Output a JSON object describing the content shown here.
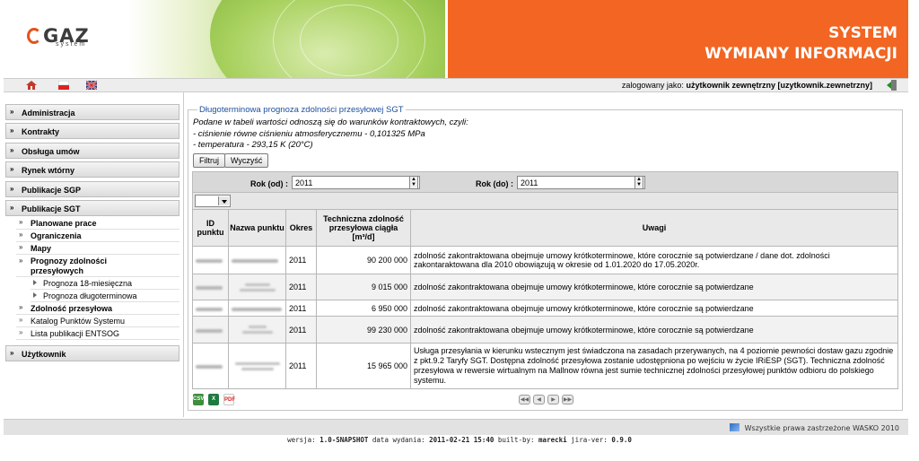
{
  "header": {
    "logo_text": "GAZ",
    "logo_sub": "system",
    "title_line1": "SYSTEM",
    "title_line2": "WYMIANY INFORMACJI"
  },
  "user_bar": {
    "logged_as_label": "zalogowany jako:",
    "user_name": "użytkownik zewnętrzny [uzytkownik.zewnetrzny]",
    "icons": [
      "home-icon",
      "polish-flag-icon",
      "uk-flag-icon",
      "logout-icon"
    ]
  },
  "sidebar": {
    "categories": {
      "administracja": "Administracja",
      "kontrakty": "Kontrakty",
      "obsluga_umow": "Obsługa umów",
      "rynek_wtorny": "Rynek wtórny",
      "publikacje_sgp": "Publikacje SGP",
      "publikacje_sgt": "Publikacje SGT",
      "uzytkownik": "Użytkownik"
    },
    "items": {
      "planowane_prace": "Planowane prace",
      "ograniczenia": "Ograniczenia",
      "mapy": "Mapy",
      "prognozy_line1": "Prognozy zdolności",
      "prognozy_line2": "przesyłowych",
      "prognoza_18": "Prognoza 18-miesięczna",
      "prognoza_dlugo": "Prognoza długoterminowa",
      "zdolnosc": "Zdolność przesyłowa",
      "katalog": "Katalog Punktów Systemu",
      "entsog": "Lista publikacji ENTSOG"
    }
  },
  "content": {
    "legend": "Długoterminowa prognoza zdolności przesyłowej SGT",
    "intro_line1": "Podane w tabeli wartości odnoszą się do warunków kontraktowych, czyli:",
    "intro_line2": "- ciśnienie równe ciśnieniu atmosferycznemu - 0,101325 MPa",
    "intro_line3": "- temperatura - 293,15 K (20°C)",
    "filter_button": "Filtruj",
    "clear_button": "Wyczyść",
    "year_from_label": "Rok (od) :",
    "year_from_value": "2011",
    "year_to_label": "Rok (do) :",
    "year_to_value": "2011"
  },
  "table": {
    "headers": {
      "id": "ID punktu",
      "name": "Nazwa punktu",
      "period": "Okres",
      "capacity_l1": "Techniczna zdolność",
      "capacity_l2": "przesyłowa ciągła",
      "capacity_l3": "[m³/d]",
      "notes": "Uwagi"
    },
    "rows": [
      {
        "period": "2011",
        "capacity": "90 200 000",
        "notes": "zdolność zakontraktowana obejmuje umowy krótkoterminowe, które corocznie są potwierdzane / dane dot. zdolności zakontaraktowana dla 2010 obowiązują w okresie od 1.01.2020 do 17.05.2020r."
      },
      {
        "period": "2011",
        "capacity": "9 015 000",
        "notes": "zdolność zakontraktowana obejmuje umowy krótkoterminowe, które corocznie są potwierdzane"
      },
      {
        "period": "2011",
        "capacity": "6 950 000",
        "notes": "zdolność zakontraktowana obejmuje umowy krótkoterminowe, które corocznie są potwierdzane"
      },
      {
        "period": "2011",
        "capacity": "99 230 000",
        "notes": "zdolność zakontraktowana obejmuje umowy krótkoterminowe, które corocznie są potwierdzane"
      },
      {
        "period": "2011",
        "capacity": "15 965 000",
        "notes": "Usługa przesyłania w kierunku wstecznym jest świadczona na zasadach przerywanych, na 4 poziomie pewności dostaw gazu zgodnie z pkt.9.2 Taryfy SGT. Dostępna zdolność przesyłowa zostanie udostępniona po wejściu w życie IRiESP (SGT). Techniczna zdolność przesyłowa w rewersie wirtualnym na Mallnow równa jest sumie technicznej zdolności przesyłowej punktów odbioru do polskiego systemu."
      }
    ]
  },
  "export_icons": [
    "csv-export-icon",
    "excel-export-icon",
    "pdf-export-icon"
  ],
  "footer": {
    "copyright": "Wszystkie prawa zastrzeżone WASKO 2010",
    "version_label": "wersja:",
    "version": "1.0-SNAPSHOT",
    "release_label": "data wydania:",
    "release_date": "2011-02-21 15:40",
    "build_label": "built-by:",
    "build_by": "marecki",
    "jira_label": "jira-ver:",
    "jira_ver": "0.9.0"
  },
  "colors": {
    "brand_orange": "#f26522",
    "legend_blue": "#1b4f9e",
    "leaf_green": "#9ac64f"
  }
}
